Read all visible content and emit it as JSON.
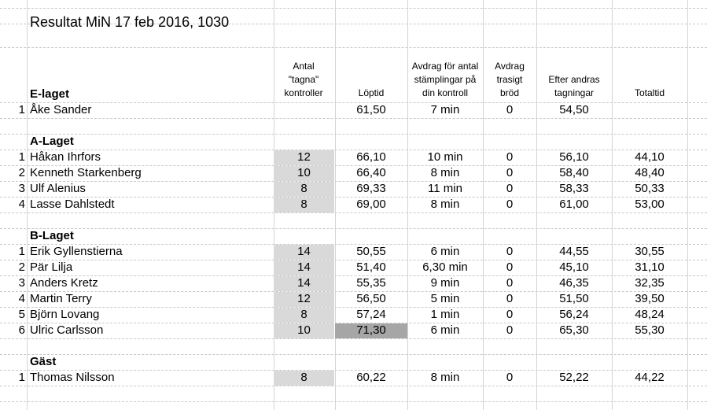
{
  "title": "Resultat MiN 17 feb 2016, 1030",
  "headers": {
    "kontroller": [
      "Antal",
      "\"tagna\"",
      "kontroller"
    ],
    "loptid": [
      "Löptid"
    ],
    "avdrag_stampling": [
      "Avdrag för antal",
      "stämplingar på",
      "din kontroll"
    ],
    "avdrag_brod": [
      "Avdrag",
      "trasigt",
      "bröd"
    ],
    "efter": [
      "Efter andras",
      "tagningar"
    ],
    "total": [
      "Totaltid"
    ]
  },
  "teams": [
    {
      "name": "E-laget",
      "rows": [
        {
          "rank": "1",
          "name": "Åke Sander",
          "kontroller": "",
          "loptid": "61,50",
          "avdrag": "7 min",
          "brod": "0",
          "efter": "54,50",
          "total": ""
        }
      ]
    },
    {
      "name": "A-Laget",
      "rows": [
        {
          "rank": "1",
          "name": "Håkan Ihrfors",
          "kontroller": "12",
          "loptid": "66,10",
          "avdrag": "10 min",
          "brod": "0",
          "efter": "56,10",
          "total": "44,10"
        },
        {
          "rank": "2",
          "name": "Kenneth Starkenberg",
          "kontroller": "10",
          "loptid": "66,40",
          "avdrag": "8 min",
          "brod": "0",
          "efter": "58,40",
          "total": "48,40"
        },
        {
          "rank": "3",
          "name": "Ulf Alenius",
          "kontroller": "8",
          "loptid": "69,33",
          "avdrag": "11 min",
          "brod": "0",
          "efter": "58,33",
          "total": "50,33"
        },
        {
          "rank": "4",
          "name": "Lasse Dahlstedt",
          "kontroller": "8",
          "loptid": "69,00",
          "avdrag": "8 min",
          "brod": "0",
          "efter": "61,00",
          "total": "53,00"
        }
      ]
    },
    {
      "name": "B-Laget",
      "rows": [
        {
          "rank": "1",
          "name": "Erik Gyllenstierna",
          "kontroller": "14",
          "loptid": "50,55",
          "avdrag": "6 min",
          "brod": "0",
          "efter": "44,55",
          "total": "30,55"
        },
        {
          "rank": "2",
          "name": "Pär Lilja",
          "kontroller": "14",
          "loptid": "51,40",
          "avdrag": "6,30 min",
          "brod": "0",
          "efter": "45,10",
          "total": "31,10"
        },
        {
          "rank": "3",
          "name": "Anders Kretz",
          "kontroller": "14",
          "loptid": "55,35",
          "avdrag": "9 min",
          "brod": "0",
          "efter": "46,35",
          "total": "32,35"
        },
        {
          "rank": "4",
          "name": "Martin Terry",
          "kontroller": "12",
          "loptid": "56,50",
          "avdrag": "5 min",
          "brod": "0",
          "efter": "51,50",
          "total": "39,50"
        },
        {
          "rank": "5",
          "name": "Björn Lovang",
          "kontroller": "8",
          "loptid": "57,24",
          "avdrag": "1 min",
          "brod": "0",
          "efter": "56,24",
          "total": "48,24"
        },
        {
          "rank": "6",
          "name": "Ulric Carlsson",
          "kontroller": "10",
          "loptid": "71,30",
          "avdrag": "6 min",
          "brod": "0",
          "efter": "65,30",
          "total": "55,30",
          "loptid_highlight": true
        }
      ]
    },
    {
      "name": "Gäst",
      "rows": [
        {
          "rank": "1",
          "name": "Thomas Nilsson",
          "kontroller": "8",
          "loptid": "60,22",
          "avdrag": "8 min",
          "brod": "0",
          "efter": "52,22",
          "total": "44,22"
        }
      ]
    }
  ],
  "colors": {
    "shade": "#d9d9d9",
    "highlight": "#a6a6a6",
    "gridline": "#c8c8c8"
  }
}
